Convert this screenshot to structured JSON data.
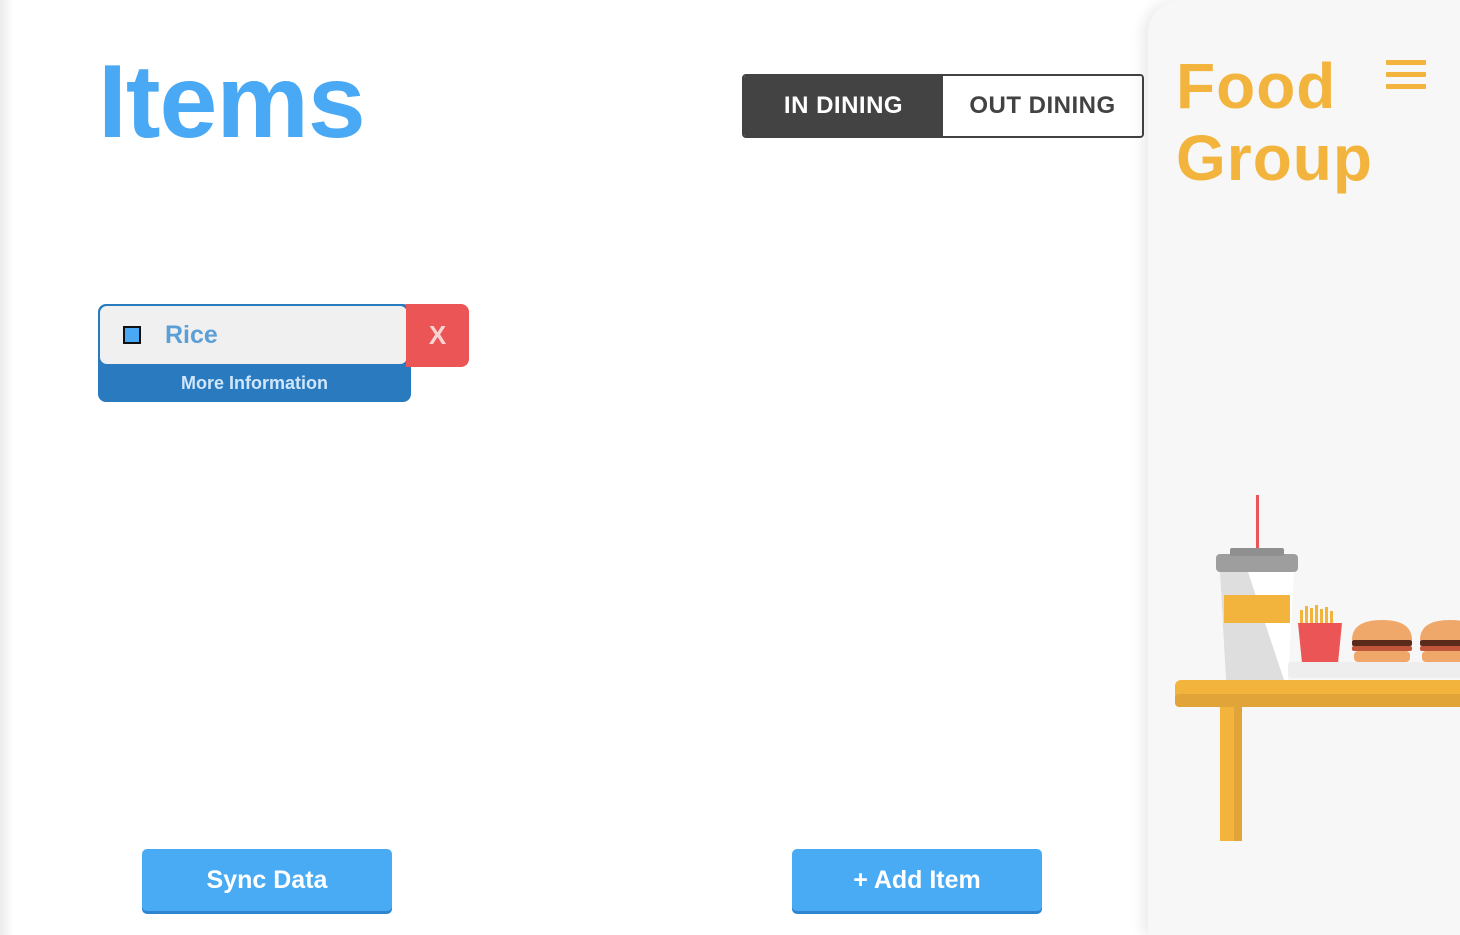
{
  "main": {
    "title": "Items",
    "toggle": {
      "in_dining_label": "IN DINING",
      "out_dining_label": "OUT DINING",
      "selected": "IN DINING"
    },
    "items": [
      {
        "label": "Rice",
        "more_info_label": "More Information",
        "delete_label": "X"
      }
    ],
    "sync_button_label": "Sync Data",
    "add_item_button_label": "+ Add Item"
  },
  "side_panel": {
    "title_line1": "Food",
    "title_line2": "Group",
    "menu_icon": "hamburger-menu-icon",
    "illustration": "fast-food-table-illustration"
  },
  "colors": {
    "primary_blue": "#4aa9f5",
    "dark_toggle": "#434343",
    "delete_red": "#ec5555",
    "accent_orange": "#f3b43e",
    "card_blue": "#2a7ac0"
  }
}
